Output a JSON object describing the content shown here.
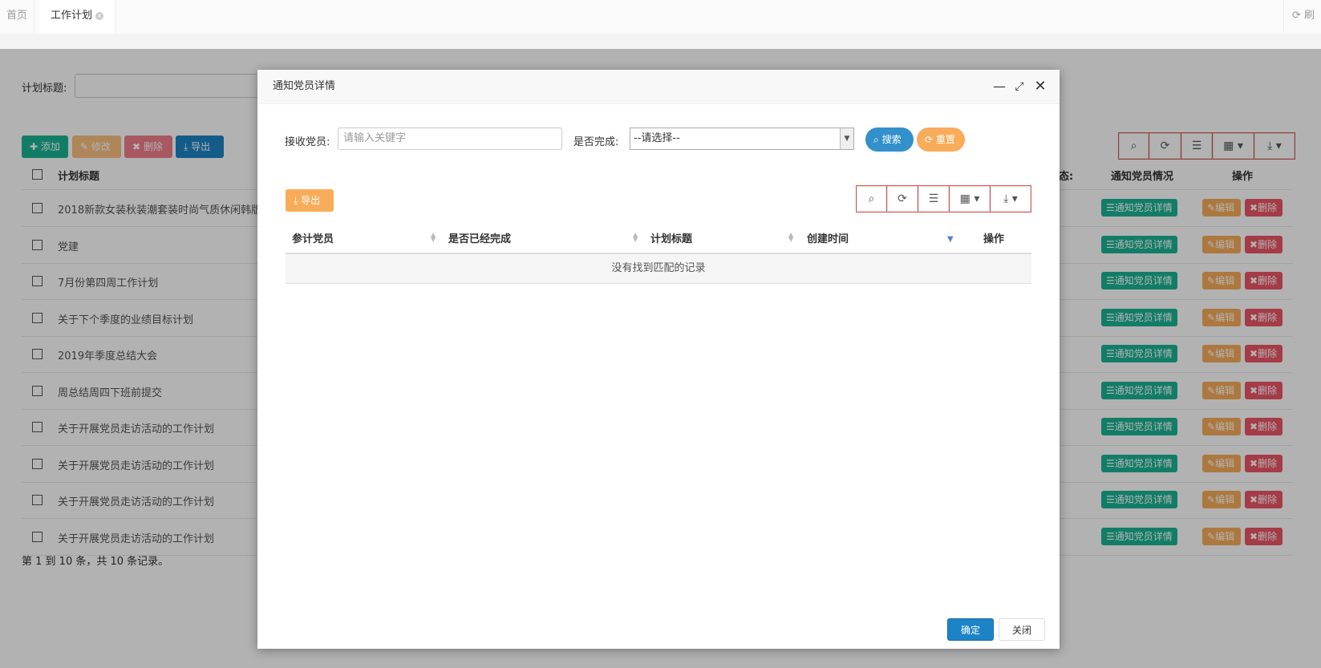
{
  "tabs": [
    {
      "label": "首页"
    },
    {
      "label": "工作计划"
    }
  ],
  "refresh_label": "刷",
  "background": {
    "filter_label": "计划标题:",
    "buttons": {
      "add": "添加",
      "edit": "修改",
      "delete": "删除",
      "export": "导出"
    },
    "columns": {
      "title": "计划标题",
      "status": "态:",
      "notify": "通知党员情况",
      "action": "操作"
    },
    "rows": [
      {
        "title": "2018新款女装秋装潮套装时尚气质休闲韩版"
      },
      {
        "title": "党建"
      },
      {
        "title": "7月份第四周工作计划"
      },
      {
        "title": "关于下个季度的业绩目标计划"
      },
      {
        "title": "2019年季度总结大会"
      },
      {
        "title": "周总结周四下班前提交"
      },
      {
        "title": "关于开展党员走访活动的工作计划"
      },
      {
        "title": "关于开展党员走访活动的工作计划"
      },
      {
        "title": "关于开展党员走访活动的工作计划"
      },
      {
        "title": "关于开展党员走访活动的工作计划"
      }
    ],
    "row_buttons": {
      "notify": "通知党员详情",
      "edit": "编辑",
      "delete": "删除"
    },
    "pagination": "第 1 到 10 条，共 10 条记录。"
  },
  "modal": {
    "title": "通知党员详情",
    "member_label": "接收党员:",
    "member_placeholder": "请输入关键字",
    "done_label": "是否完成:",
    "done_selected": "--请选择--",
    "search_btn": "搜索",
    "reset_btn": "重置",
    "export_btn": "导出",
    "columns": [
      "参计党员",
      "是否已经完成",
      "计划标题",
      "创建时间",
      "操作"
    ],
    "empty_text": "没有找到匹配的记录",
    "ok_btn": "确定",
    "close_btn": "关闭"
  }
}
